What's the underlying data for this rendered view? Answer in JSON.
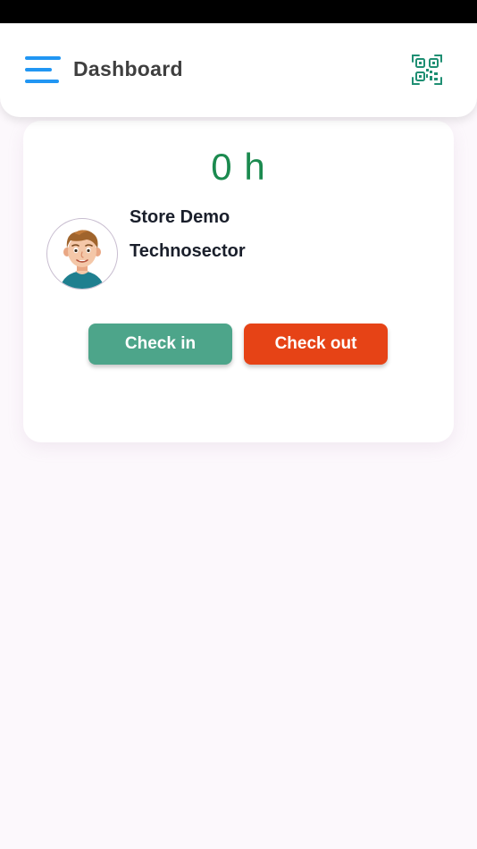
{
  "header": {
    "title": "Dashboard",
    "menu_icon": "menu-icon",
    "qr_icon": "qr-code-icon"
  },
  "summary": {
    "hours": "0 h"
  },
  "profile": {
    "name": "Store Demo",
    "company": "Technosector",
    "avatar_icon": "avatar-illustration"
  },
  "actions": {
    "check_in_label": "Check in",
    "check_out_label": "Check out"
  },
  "colors": {
    "accent_blue": "#2196f3",
    "qr_green": "#1f8f73",
    "hours_green": "#1b8a4f",
    "check_in": "#4da58a",
    "check_out": "#e64316",
    "title_text": "#3f3f3f",
    "body_text": "#1a1f2b",
    "background": "#fcf8fc"
  }
}
